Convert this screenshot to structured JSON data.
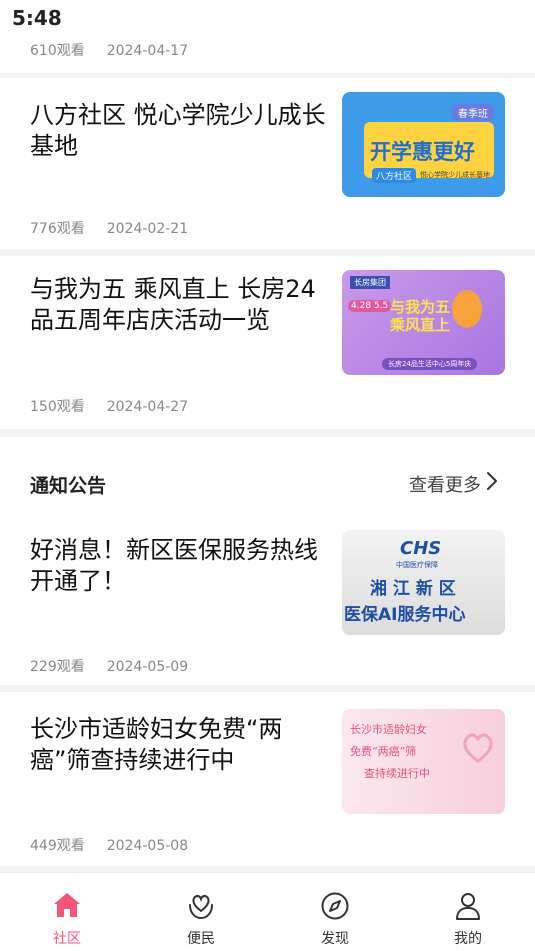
{
  "status_bar": {
    "time": "5:48"
  },
  "articles": [
    {
      "views": "610观看",
      "date": "2024-04-17"
    },
    {
      "title": "八方社区 悦心学院少儿成长基地",
      "views": "776观看",
      "date": "2024-02-21",
      "thumb": {
        "badge": "春季班",
        "headline": "开学惠更好",
        "tag": "八方社区",
        "sub": "悦心学院少儿成长基地"
      }
    },
    {
      "title": "与我为五 乘风直上  长房24品五周年店庆活动一览",
      "views": "150观看",
      "date": "2024-04-27",
      "thumb": {
        "brand": "长房集团",
        "date_tag": "4.28 5.5",
        "headline": "与我为五 乘风直上",
        "sub": "长房24品生活中心5周年庆"
      }
    }
  ],
  "notice_section": {
    "title": "通知公告",
    "more_label": "查看更多"
  },
  "notices": [
    {
      "title": "好消息！新区医保服务热线开通了！",
      "views": "229观看",
      "date": "2024-05-09",
      "thumb": {
        "logo": "CHS",
        "logo_sub": "中国医疗保障",
        "line1": "湘 江 新 区",
        "line2": "医保AI服务中心"
      }
    },
    {
      "title": "长沙市适龄妇女免费“两癌”筛查持续进行中",
      "views": "449观看",
      "date": "2024-05-08",
      "thumb": {
        "line1": "长沙市适龄妇女",
        "line2": "免费“两癌”筛",
        "line3": "查持续进行中"
      }
    }
  ],
  "tabbar": {
    "items": [
      {
        "label": "社区",
        "icon": "home-icon",
        "active": true
      },
      {
        "label": "便民",
        "icon": "heart-hand-icon",
        "active": false
      },
      {
        "label": "发现",
        "icon": "compass-icon",
        "active": false
      },
      {
        "label": "我的",
        "icon": "user-icon",
        "active": false
      }
    ]
  },
  "colors": {
    "accent": "#f2567a"
  }
}
